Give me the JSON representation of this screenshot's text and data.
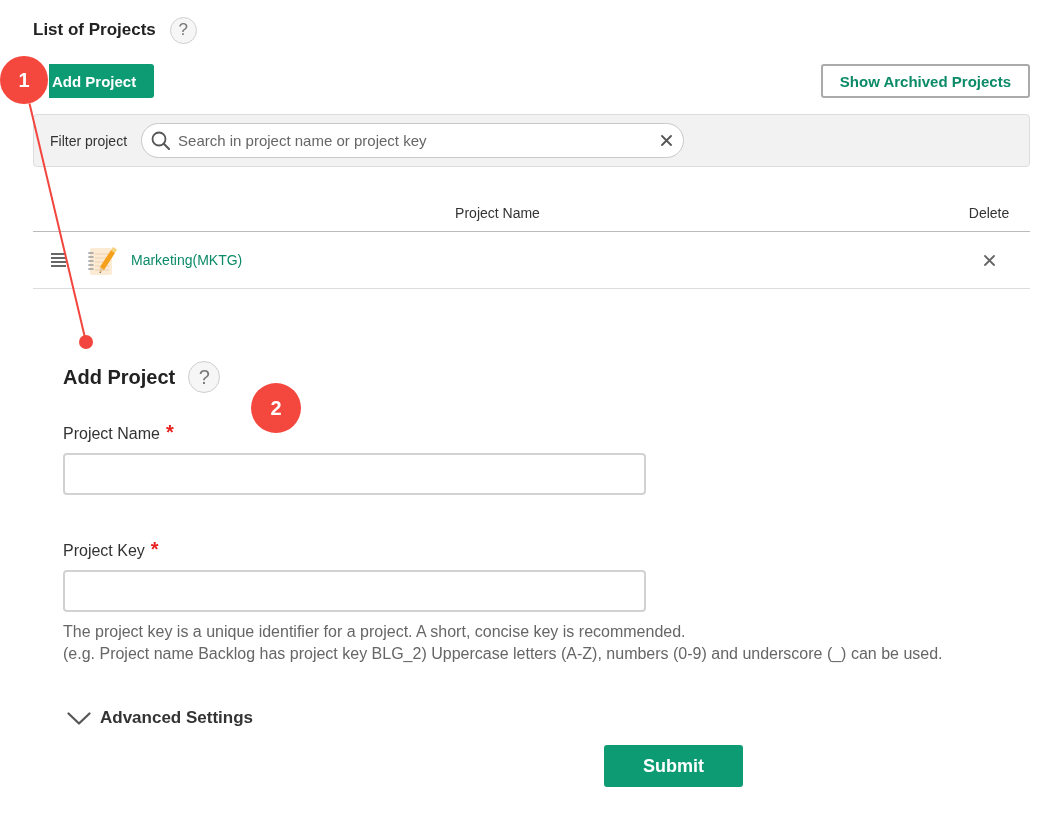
{
  "header": {
    "title": "List of Projects",
    "help": "?"
  },
  "toolbar": {
    "buttons": [
      {
        "label": "Add Project",
        "kind": "primary"
      },
      {
        "label": "Show Archived Projects",
        "kind": "secondary"
      }
    ]
  },
  "filter": {
    "label": "Filter project",
    "placeholder": "Search in project name or project key"
  },
  "table": {
    "columns": [
      {
        "label": "Project Name"
      },
      {
        "label": "Delete"
      }
    ],
    "rows": [
      {
        "name": "Marketing(MKTG)"
      }
    ]
  },
  "form": {
    "title": "Add Project",
    "help": "?",
    "fields": [
      {
        "label": "Project Name",
        "required_mark": "*"
      },
      {
        "label": "Project Key",
        "required_mark": "*"
      }
    ],
    "hint": [
      "The project key is a unique identifier for a project. A short, concise key is recommended.",
      "(e.g. Project name Backlog has project key BLG_2) Uppercase letters (A-Z), numbers (0-9) and underscore (_) can be used."
    ],
    "advanced": {
      "label": "Advanced Settings",
      "expanded": false
    },
    "submit": "Submit"
  },
  "callouts": [
    {
      "number": "1",
      "pointer": true
    },
    {
      "number": "2",
      "pointer": false
    }
  ]
}
